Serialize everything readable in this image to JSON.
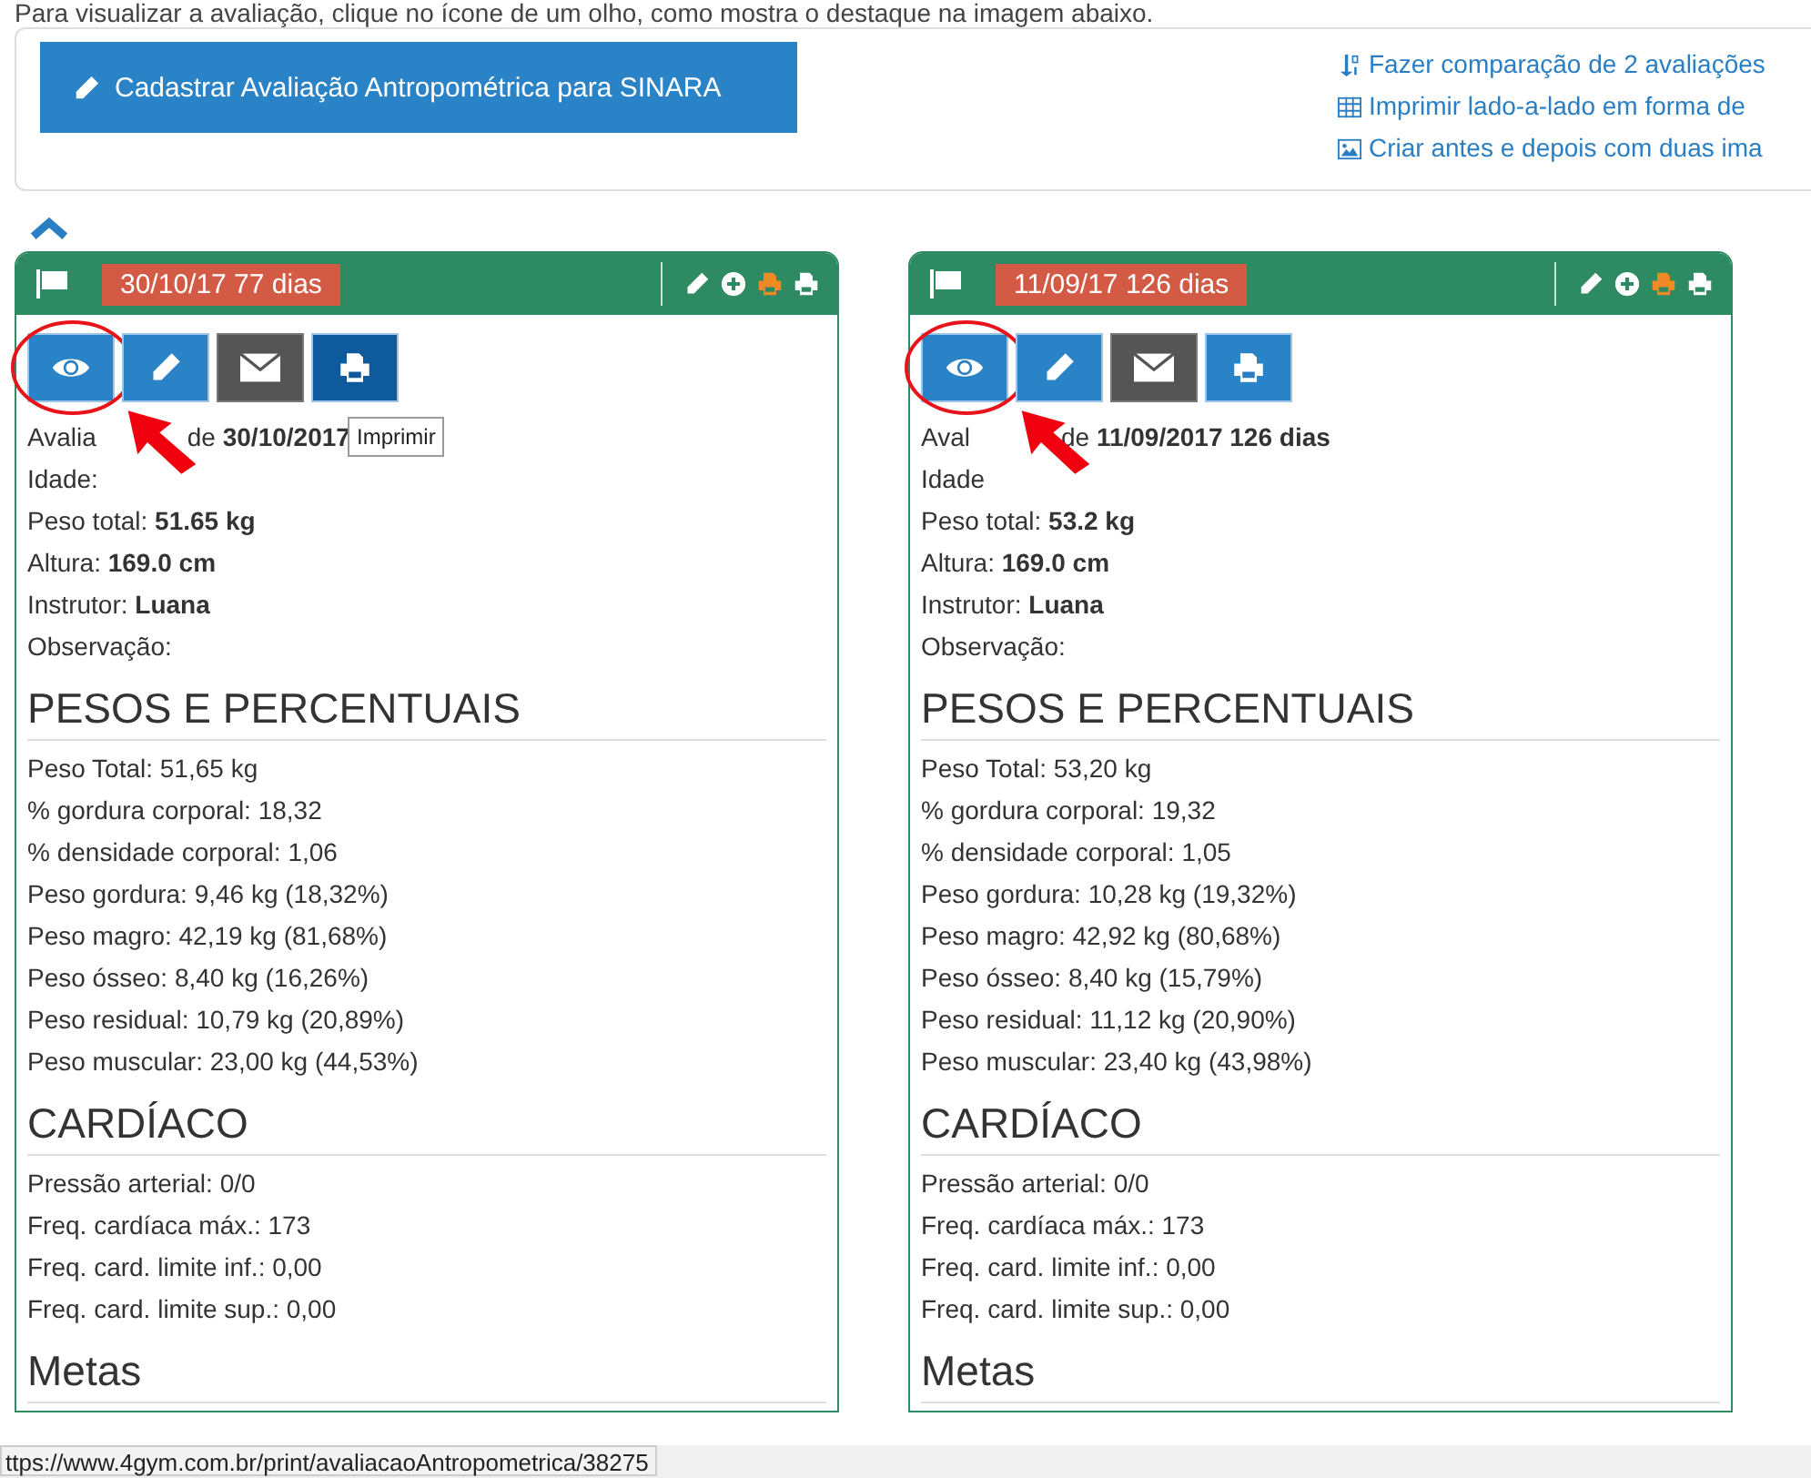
{
  "intro": "Para visualizar a avaliação, clique no ícone de um olho, como mostra o destaque na imagem abaixo.",
  "register_button": "Cadastrar Avaliação Antropométrica para SINARA",
  "links": [
    {
      "kind": "compare",
      "label": "Fazer comparação de 2 avaliações"
    },
    {
      "kind": "table",
      "label": "Imprimir lado-a-lado em forma de"
    },
    {
      "kind": "image",
      "label": "Criar antes e depois com duas ima"
    }
  ],
  "cards": [
    {
      "tag": "30/10/17 77 dias",
      "tooltip": "Imprimir",
      "buttons": [
        {
          "kind": "view",
          "hovered": false,
          "highlighted": true
        },
        {
          "kind": "edit",
          "hovered": false,
          "highlighted": false
        },
        {
          "kind": "email",
          "hovered": false,
          "highlighted": false
        },
        {
          "kind": "print",
          "hovered": true,
          "highlighted": false
        }
      ],
      "info": [
        {
          "text": "Avalia",
          "rest": "de **30/10/2017**"
        },
        {
          "text": "Idade:"
        },
        {
          "text": "Peso total: **51.65 kg**"
        },
        {
          "text": "Altura: **169.0 cm**"
        },
        {
          "text": "Instrutor: **Luana**"
        },
        {
          "text": "Observação:"
        }
      ],
      "sections": [
        {
          "title": "PESOS E PERCENTUAIS",
          "lines": [
            "Peso Total: 51,65 kg",
            "% gordura corporal: 18,32",
            "% densidade corporal: 1,06",
            "Peso gordura: 9,46 kg (18,32%)",
            "Peso magro: 42,19 kg (81,68%)",
            "Peso ósseo: 8,40 kg (16,26%)",
            "Peso residual: 10,79 kg (20,89%)",
            "Peso muscular: 23,00 kg (44,53%)"
          ]
        },
        {
          "title": "CARDÍACO",
          "lines": [
            "Pressão arterial: 0/0",
            "Freq. cardíaca máx.: 173",
            "Freq. card. limite inf.: 0,00",
            "Freq. card. limite sup.: 0,00"
          ]
        },
        {
          "title": "Metas"
        }
      ]
    },
    {
      "tag": "11/09/17 126 dias",
      "buttons": [
        {
          "kind": "view",
          "hovered": false,
          "highlighted": true
        },
        {
          "kind": "edit",
          "hovered": false,
          "highlighted": false
        },
        {
          "kind": "email",
          "hovered": false,
          "highlighted": false
        },
        {
          "kind": "print",
          "hovered": false,
          "highlighted": false
        }
      ],
      "info": [
        {
          "text": "Aval",
          "rest": "de **11/09/2017 126 dias**"
        },
        {
          "text": "Idade"
        },
        {
          "text": "Peso total: **53.2 kg**"
        },
        {
          "text": "Altura: **169.0 cm**"
        },
        {
          "text": "Instrutor: **Luana**"
        },
        {
          "text": "Observação:"
        }
      ],
      "sections": [
        {
          "title": "PESOS E PERCENTUAIS",
          "lines": [
            "Peso Total: 53,20 kg",
            "% gordura corporal: 19,32",
            "% densidade corporal: 1,05",
            "Peso gordura: 10,28 kg (19,32%)",
            "Peso magro: 42,92 kg (80,68%)",
            "Peso ósseo: 8,40 kg (15,79%)",
            "Peso residual: 11,12 kg (20,90%)",
            "Peso muscular: 23,40 kg (43,98%)"
          ]
        },
        {
          "title": "CARDÍACO",
          "lines": [
            "Pressão arterial: 0/0",
            "Freq. cardíaca máx.: 173",
            "Freq. card. limite inf.: 0,00",
            "Freq. card. limite sup.: 0,00"
          ]
        },
        {
          "title": "Metas"
        }
      ]
    }
  ],
  "status_bar": "ttps://www.4gym.com.br/print/avaliacaoAntropometrica/38275"
}
